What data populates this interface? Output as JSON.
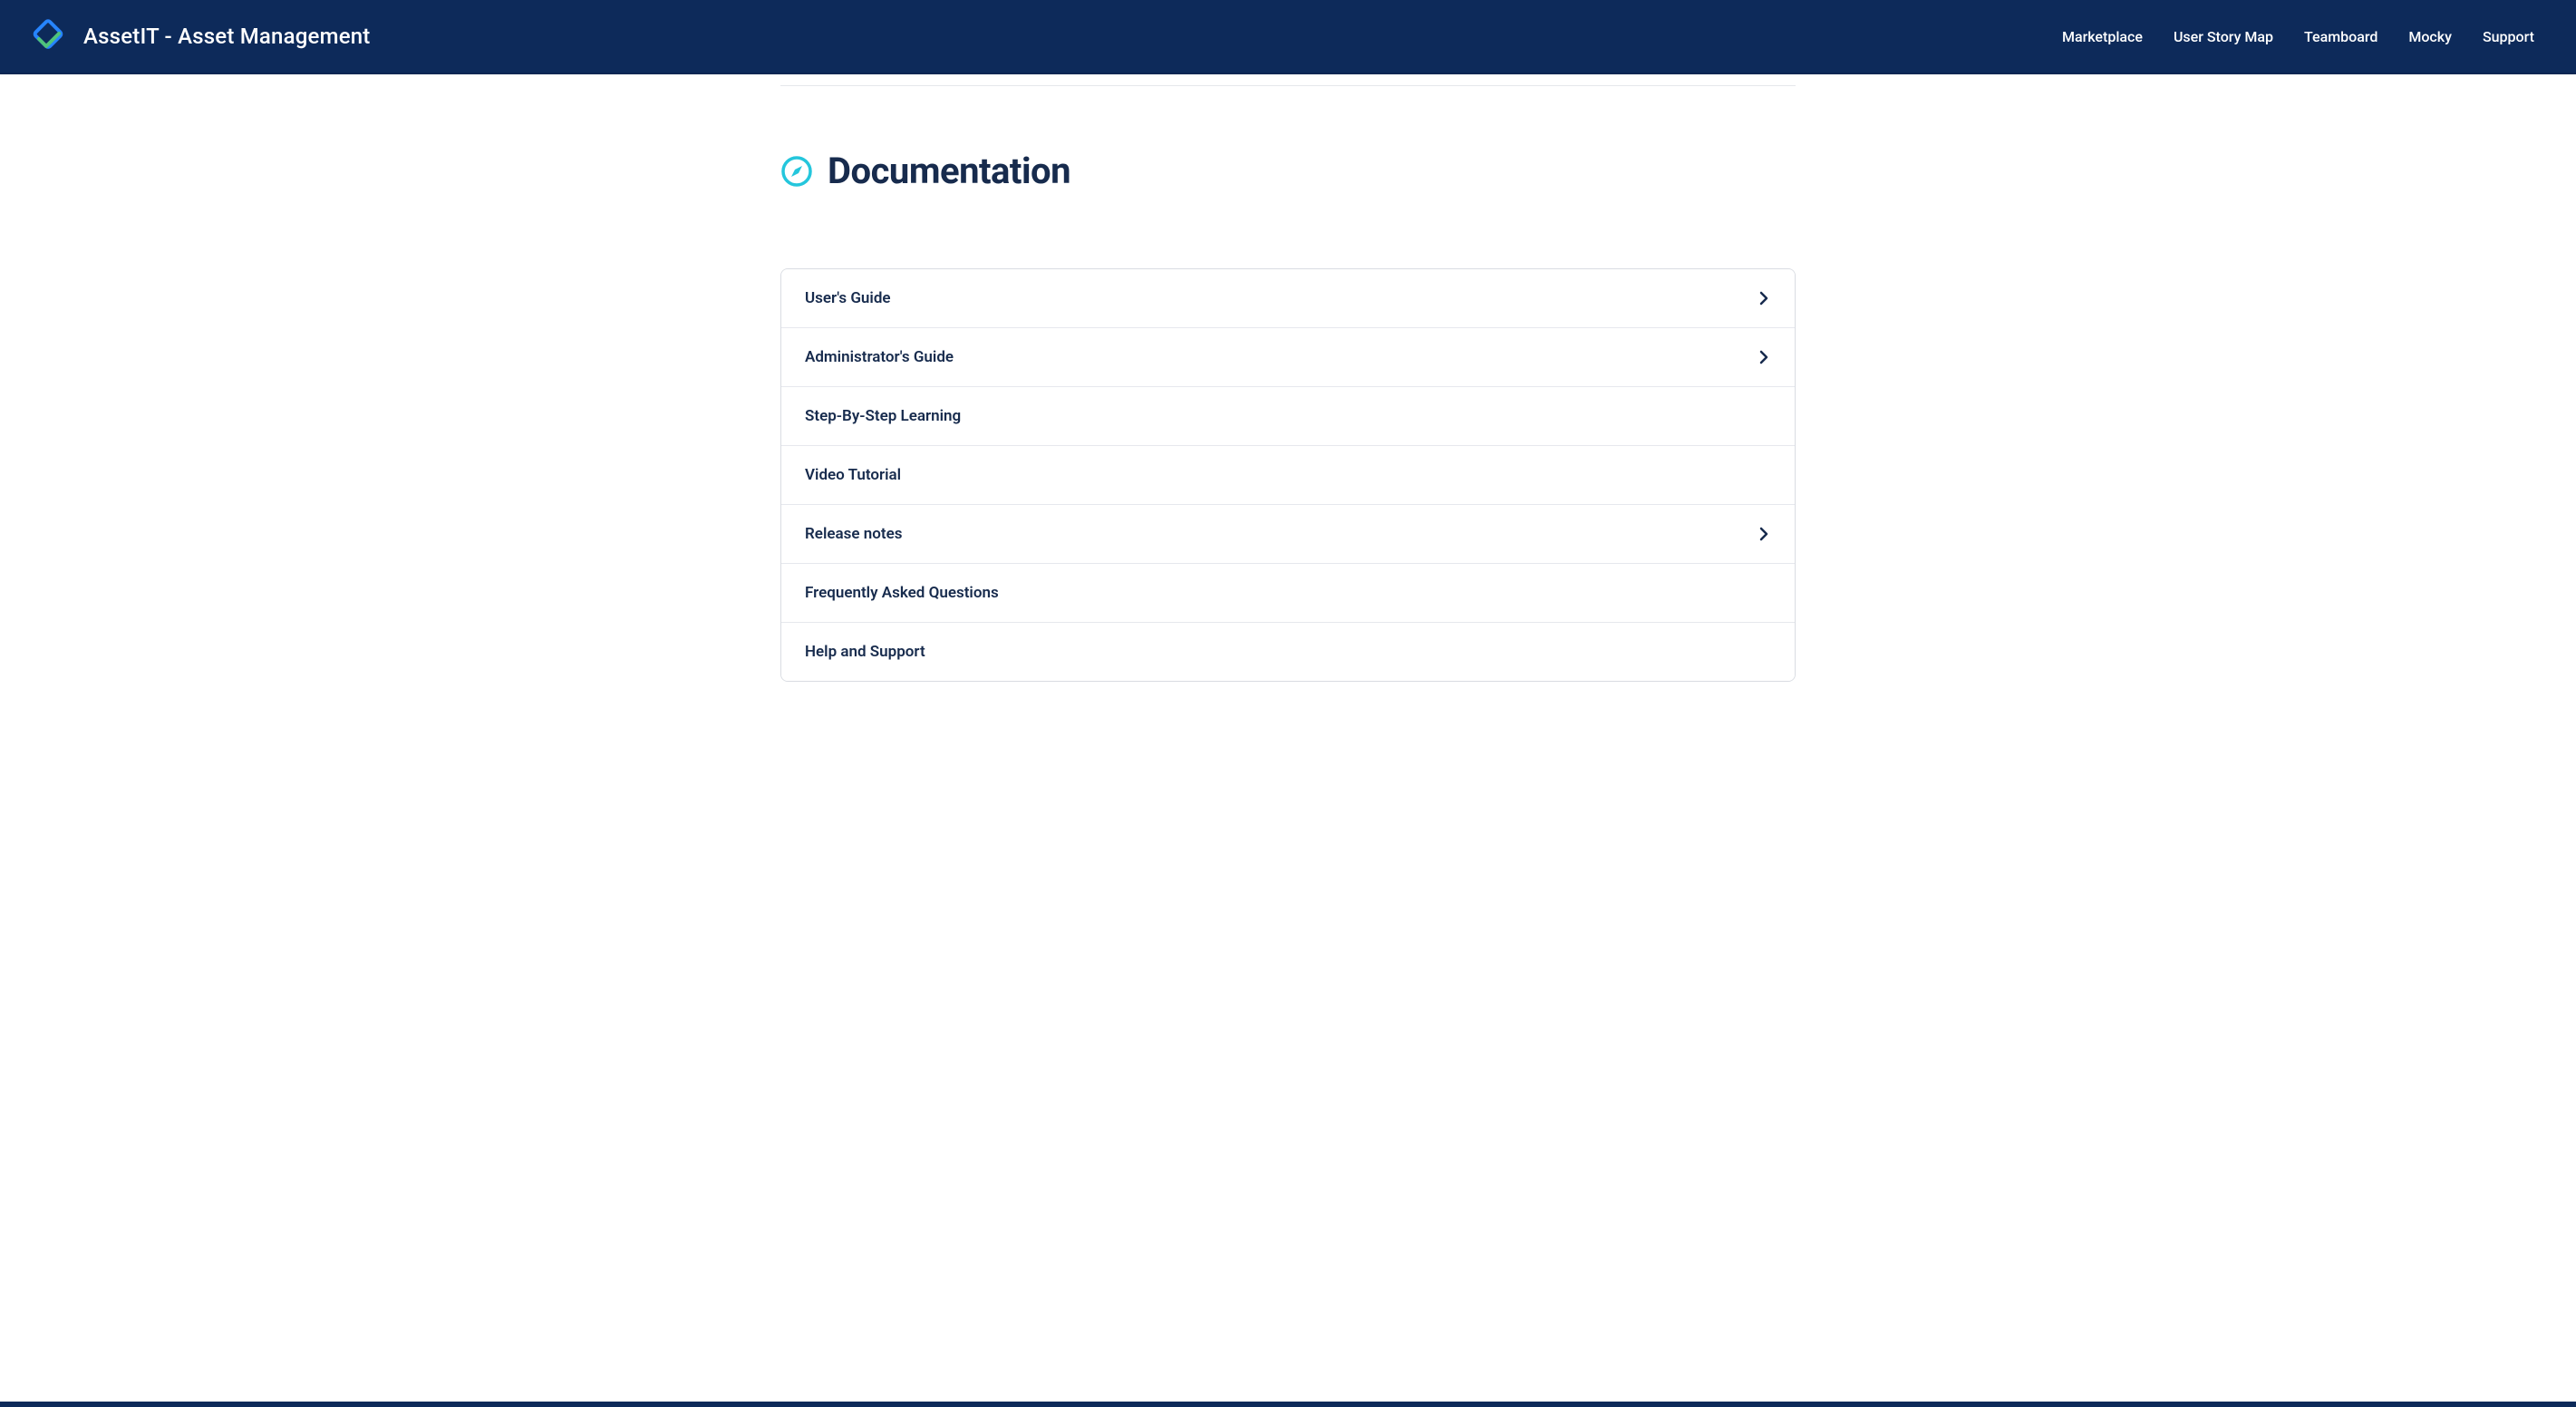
{
  "header": {
    "product_title": "AssetIT - Asset Management",
    "nav": [
      {
        "label": "Marketplace",
        "name": "nav-marketplace"
      },
      {
        "label": "User Story Map",
        "name": "nav-user-story-map"
      },
      {
        "label": "Teamboard",
        "name": "nav-teamboard"
      },
      {
        "label": "Mocky",
        "name": "nav-mocky"
      },
      {
        "label": "Support",
        "name": "nav-support"
      }
    ]
  },
  "page": {
    "heading": "Documentation"
  },
  "docs": [
    {
      "label": "User's Guide",
      "has_children": true,
      "name": "doc-users-guide"
    },
    {
      "label": "Administrator's Guide",
      "has_children": true,
      "name": "doc-admin-guide"
    },
    {
      "label": "Step-By-Step Learning",
      "has_children": false,
      "name": "doc-step-by-step"
    },
    {
      "label": "Video Tutorial",
      "has_children": false,
      "name": "doc-video-tutorial"
    },
    {
      "label": "Release notes",
      "has_children": true,
      "name": "doc-release-notes"
    },
    {
      "label": "Frequently Asked Questions",
      "has_children": false,
      "name": "doc-faq"
    },
    {
      "label": "Help and Support",
      "has_children": false,
      "name": "doc-help-support"
    }
  ],
  "colors": {
    "nav_bg": "#0d2a5a",
    "text_primary": "#172b4d",
    "accent_icon": "#24c6dc"
  }
}
